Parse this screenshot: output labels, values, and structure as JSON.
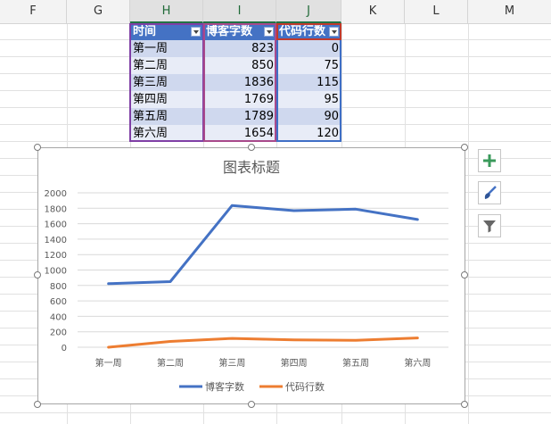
{
  "columns": [
    "F",
    "G",
    "H",
    "I",
    "J",
    "K",
    "L",
    "M"
  ],
  "table": {
    "headers": [
      "时间",
      "博客字数",
      "代码行数"
    ],
    "rows": [
      [
        "第一周",
        "823",
        "0"
      ],
      [
        "第二周",
        "850",
        "75"
      ],
      [
        "第三周",
        "1836",
        "115"
      ],
      [
        "第四周",
        "1769",
        "95"
      ],
      [
        "第五周",
        "1789",
        "90"
      ],
      [
        "第六周",
        "1654",
        "120"
      ]
    ]
  },
  "chart_data": {
    "type": "line",
    "title": "图表标题",
    "categories": [
      "第一周",
      "第二周",
      "第三周",
      "第四周",
      "第五周",
      "第六周"
    ],
    "series": [
      {
        "name": "博客字数",
        "values": [
          823,
          850,
          1836,
          1769,
          1789,
          1654
        ],
        "color": "#4472c4"
      },
      {
        "name": "代码行数",
        "values": [
          0,
          75,
          115,
          95,
          90,
          120
        ],
        "color": "#ed7d31"
      }
    ],
    "ylim": [
      0,
      2000
    ],
    "yticks": [
      "0",
      "200",
      "400",
      "600",
      "800",
      "1000",
      "1200",
      "1400",
      "1600",
      "1800",
      "2000"
    ],
    "grid": true,
    "legend": "bottom"
  },
  "side_buttons": [
    {
      "icon": "plus-icon",
      "color": "#3a9a5b"
    },
    {
      "icon": "brush-icon",
      "color": "#4472c4"
    },
    {
      "icon": "filter-icon",
      "color": "#666666"
    }
  ]
}
